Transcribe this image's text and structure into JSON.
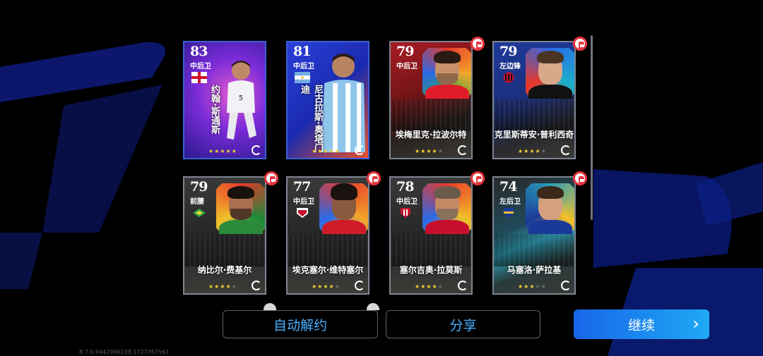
{
  "cards": [
    {
      "rating": "83",
      "position": "中后卫",
      "name": "约翰·斯通斯",
      "stars": 5,
      "flag": "england",
      "style": "featured-pink"
    },
    {
      "rating": "81",
      "position": "中后卫",
      "name": "尼古拉斯·奥塔门迪",
      "stars": 5,
      "flag": "argentina",
      "style": "featured-blue"
    },
    {
      "rating": "79",
      "position": "中后卫",
      "name": "埃梅里克·拉波尔特",
      "stars": 4,
      "flag": "",
      "style": "standard-red",
      "release": true
    },
    {
      "rating": "79",
      "position": "左边锋",
      "name": "克里斯蒂安·普利西奇",
      "stars": 4,
      "flag": "milan",
      "style": "standard-blue",
      "release": true
    },
    {
      "rating": "79",
      "position": "前腰",
      "name": "纳比尔·费基尔",
      "stars": 4,
      "flag": "club-green",
      "style": "standard-gray",
      "release": true
    },
    {
      "rating": "77",
      "position": "中后卫",
      "name": "埃克塞尔·维特塞尔",
      "stars": 4,
      "flag": "club-red",
      "style": "standard-gray",
      "release": true
    },
    {
      "rating": "78",
      "position": "中后卫",
      "name": "塞尔吉奥·拉莫斯",
      "stars": 4,
      "flag": "club-redwhite",
      "style": "standard-gray",
      "release": true
    },
    {
      "rating": "74",
      "position": "左后卫",
      "name": "马塞洛·萨拉基",
      "stars": 3,
      "flag": "boca",
      "style": "standard-teal",
      "release": true
    }
  ],
  "buttons": {
    "auto_release": "自动解约",
    "share": "分享",
    "continue": "继续"
  },
  "version": "8.7.0.9442990238.1727767561"
}
